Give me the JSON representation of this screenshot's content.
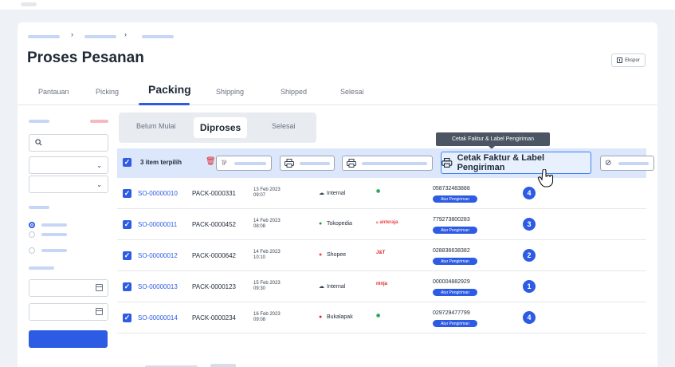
{
  "page": {
    "title": "Proses Pesanan",
    "export_label": "Ekspor"
  },
  "tabs": [
    "Pantauan",
    "Picking",
    "Packing",
    "Shipping",
    "Shipped",
    "Selesai"
  ],
  "active_tab": "Packing",
  "subtabs": [
    "Belum Mulai",
    "Diproses",
    "Selesai"
  ],
  "active_subtab": "Diproses",
  "toolbar": {
    "selected_label": "3 item terpilih",
    "print_invoice_label": "Cetak Faktur & Label Pengiriman",
    "tooltip": "Cetak Faktur & Label Pengiriman"
  },
  "rows": [
    {
      "so": "SO-00000010",
      "pack": "PACK-0000331",
      "date": "13 Feb 2023",
      "time": "09:07",
      "channel": "Internal",
      "courier": "gosend",
      "tracking": "058732483888",
      "action": "Atur Pengiriman",
      "count": "4"
    },
    {
      "so": "SO-00000011",
      "pack": "PACK-0000452",
      "date": "14 Feb 2023",
      "time": "08:08",
      "channel": "Tokopedia",
      "courier": "anteraja",
      "tracking": "779273800283",
      "action": "Atur Pengiriman",
      "count": "3"
    },
    {
      "so": "SO-00000012",
      "pack": "PACK-0000642",
      "date": "14 Feb 2023",
      "time": "10:10",
      "channel": "Shopee",
      "courier": "jnt",
      "tracking": "028836638382",
      "action": "Atur Pengiriman",
      "count": "2"
    },
    {
      "so": "SO-00000013",
      "pack": "PACK-0000123",
      "date": "15 Feb 2023",
      "time": "09:30",
      "channel": "Internal",
      "courier": "ninja",
      "tracking": "000004882929",
      "action": "Atur Pengiriman",
      "count": "1"
    },
    {
      "so": "SO-00000014",
      "pack": "PACK-0000234",
      "date": "16 Feb 2023",
      "time": "09:08",
      "channel": "Bukalapak",
      "courier": "gosend",
      "tracking": "029729477799",
      "action": "Atur Pengiriman",
      "count": "4"
    }
  ],
  "colors": {
    "primary": "#2d5be3",
    "danger": "#dc2626",
    "header_bg": "#dde7fb"
  }
}
